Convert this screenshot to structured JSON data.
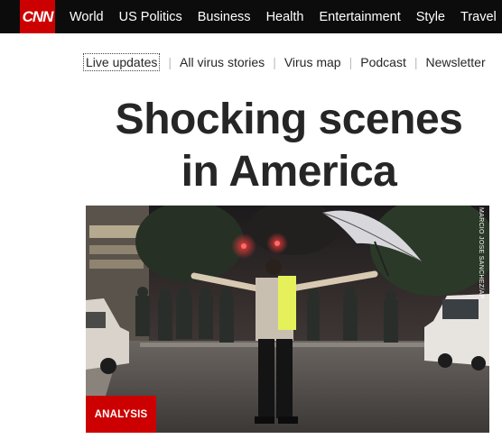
{
  "brand": {
    "logo_text": "CNN",
    "accent_color": "#cc0000"
  },
  "topnav": {
    "items": [
      {
        "label": "World"
      },
      {
        "label": "US Politics"
      },
      {
        "label": "Business"
      },
      {
        "label": "Health"
      },
      {
        "label": "Entertainment"
      },
      {
        "label": "Style"
      },
      {
        "label": "Travel"
      }
    ]
  },
  "subnav": {
    "items": [
      {
        "label": "Live updates"
      },
      {
        "label": "All virus stories"
      },
      {
        "label": "Virus map"
      },
      {
        "label": "Podcast"
      },
      {
        "label": "Newsletter"
      }
    ]
  },
  "story": {
    "headline_line1": "Shocking scenes",
    "headline_line2": "in America",
    "badge": "ANALYSIS",
    "photo_credit": "MARCIO JOSE SANCHEZ/AP"
  }
}
